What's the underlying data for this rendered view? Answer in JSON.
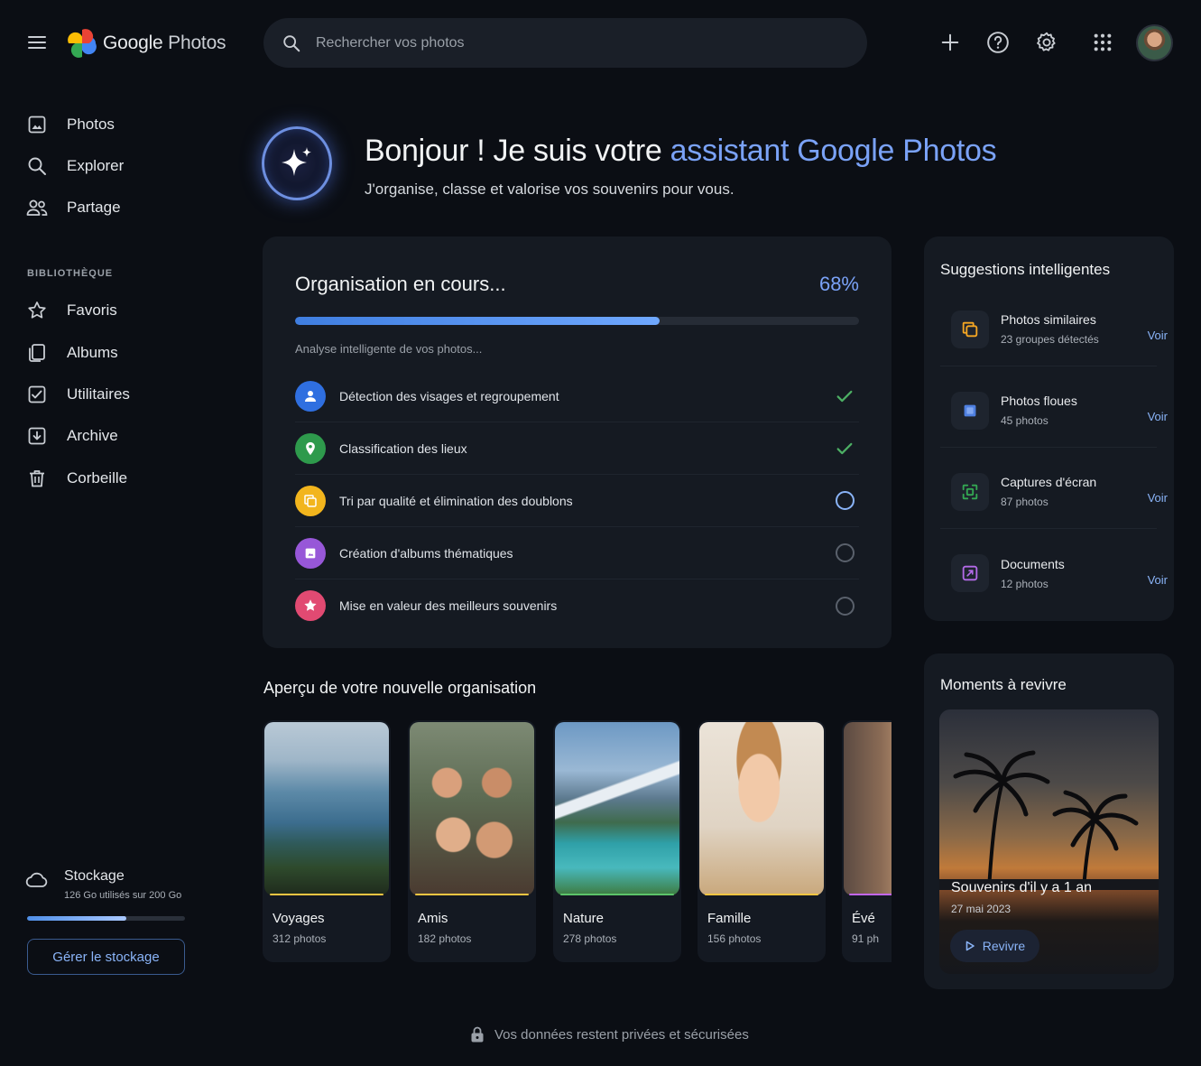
{
  "app": {
    "logo_google": "Google",
    "logo_photos": "Photos"
  },
  "search": {
    "placeholder": "Rechercher vos photos"
  },
  "sidebar": {
    "items": [
      {
        "label": "Photos",
        "icon": "photo-icon"
      },
      {
        "label": "Explorer",
        "icon": "search-icon"
      },
      {
        "label": "Partage",
        "icon": "people-icon"
      }
    ],
    "section_label": "BIBLIOTHÈQUE",
    "library": [
      {
        "label": "Favoris",
        "icon": "star-icon"
      },
      {
        "label": "Albums",
        "icon": "albums-icon"
      },
      {
        "label": "Utilitaires",
        "icon": "utilities-icon"
      },
      {
        "label": "Archive",
        "icon": "archive-icon"
      },
      {
        "label": "Corbeille",
        "icon": "trash-icon"
      }
    ],
    "storage": {
      "title": "Stockage",
      "detail": "126 Go utilisés sur 200 Go",
      "used_fraction": 0.63,
      "button": "Gérer le stockage"
    }
  },
  "hero": {
    "title_prefix": "Bonjour ! Je suis votre ",
    "title_accent": "assistant Google Photos",
    "subtitle": "J'organise, classe et valorise vos souvenirs pour vous."
  },
  "organization": {
    "title": "Organisation en cours...",
    "percent_label": "68%",
    "progress_fraction": 0.646,
    "status": "Analyse intelligente de vos photos...",
    "tasks": [
      {
        "label": "Détection des visages et regroupement",
        "state": "done",
        "color": "#4a8af0",
        "icon": "person-icon"
      },
      {
        "label": "Classification des lieux",
        "state": "done",
        "color": "#34a853",
        "icon": "location-icon"
      },
      {
        "label": "Tri par qualité et élimination des doublons",
        "state": "active",
        "color": "#fbbc04",
        "icon": "duplicate-icon"
      },
      {
        "label": "Création d'albums thématiques",
        "state": "pending",
        "color": "#a25de0",
        "icon": "album-icon"
      },
      {
        "label": "Mise en valeur des meilleurs souvenirs",
        "state": "pending",
        "color": "#e8547a",
        "icon": "star-icon"
      }
    ]
  },
  "suggestions": {
    "title": "Suggestions intelligentes",
    "items": [
      {
        "name": "Photos similaires",
        "count": "23 groupes détectés",
        "link": "Voir",
        "icon": "similar-photos-icon",
        "color": "#f5a623"
      },
      {
        "name": "Photos floues",
        "count": "45 photos",
        "link": "Voir",
        "icon": "blur-icon",
        "color": "#5b8def"
      },
      {
        "name": "Captures d'écran",
        "count": "87 photos",
        "link": "Voir",
        "icon": "screenshot-icon",
        "color": "#34a853"
      },
      {
        "name": "Documents",
        "count": "12 photos",
        "link": "Voir",
        "icon": "document-icon",
        "color": "#b36ae8"
      }
    ]
  },
  "preview": {
    "title": "Aperçu de votre nouvelle organisation",
    "albums": [
      {
        "name": "Voyages",
        "count": "312 photos",
        "accent": "#f5c542"
      },
      {
        "name": "Amis",
        "count": "182 photos",
        "accent": "#f5c542"
      },
      {
        "name": "Nature",
        "count": "278 photos",
        "accent": "#5cc46a"
      },
      {
        "name": "Famille",
        "count": "156 photos",
        "accent": "#f5c542"
      },
      {
        "name": "Évé",
        "count": "91 ph",
        "accent": "#c266f0"
      }
    ]
  },
  "moments": {
    "title": "Moments à revivre",
    "memory_title": "Souvenirs d'il y a 1 an",
    "memory_date": "27 mai 2023",
    "button": "Revivre"
  },
  "footer": {
    "text": "Vos données restent privées et sécurisées"
  }
}
